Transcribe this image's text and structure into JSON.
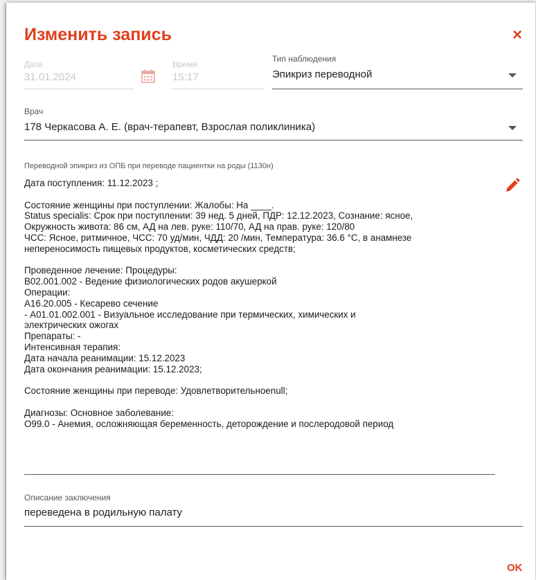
{
  "dialog": {
    "title": "Изменить запись",
    "close_symbol": "×",
    "ok_label": "OK"
  },
  "date": {
    "label": "Дата",
    "value": "31.01.2024"
  },
  "time": {
    "label": "Время",
    "value": "15:17"
  },
  "observation_type": {
    "label": "Тип наблюдения",
    "value": "Эпикриз переводной"
  },
  "doctor": {
    "label": "Врач",
    "value": "178 Черкасова А. Е.  (врач-терапевт, Взрослая поликлиника)"
  },
  "epicrisis": {
    "caption": "Переводной эпикриз из ОПБ при переводе пациентки на роды (1130н)",
    "text": "Дата поступления: 11.12.2023 ;\n\nСостояние женщины при поступлении: Жалобы: На ____.\nStatus specialis: Срок при поступлении: 39 нед. 5 дней, ПДР: 12.12.2023, Сознание: ясное,\nОкружность живота: 86 см, АД на лев. руке: 110/70, АД на прав. руке: 120/80\nЧСС: Ясное, ритмичное, ЧСС: 70 уд/мин, ЧДД: 20 /мин, Температура: 36.6 °C, в анамнезе\nнепереносимость пищевых продуктов, косметических средств;\n\nПроведенное лечение: Процедуры:\nB02.001.002 - Ведение физиологических родов акушеркой\nОперации:\nA16.20.005 - Кесарево сечение\n- A01.01.002.001 - Визуальное исследование при термических, химических и\nэлектрических ожогах\nПрепараты: -\nИнтенсивная терапия:\nДата начала реанимации: 15.12.2023\nДата окончания реанимации: 15.12.2023;\n\nСостояние женщины при переводе: Удовлетворительноеnull;\n\nДиагнозы: Основное заболевание:\nO99.0 - Анемия, осложняющая беременность, деторождение и послеродовой период"
  },
  "conclusion": {
    "label": "Описание заключения",
    "value": "переведена в родильную палату"
  },
  "colors": {
    "accent": "#e0401e",
    "text": "#212121",
    "disabled": "#c8c8c8"
  },
  "icons": {
    "calendar": "calendar-icon",
    "edit": "pencil-icon",
    "close": "close-icon",
    "dropdown": "chevron-down-icon"
  }
}
